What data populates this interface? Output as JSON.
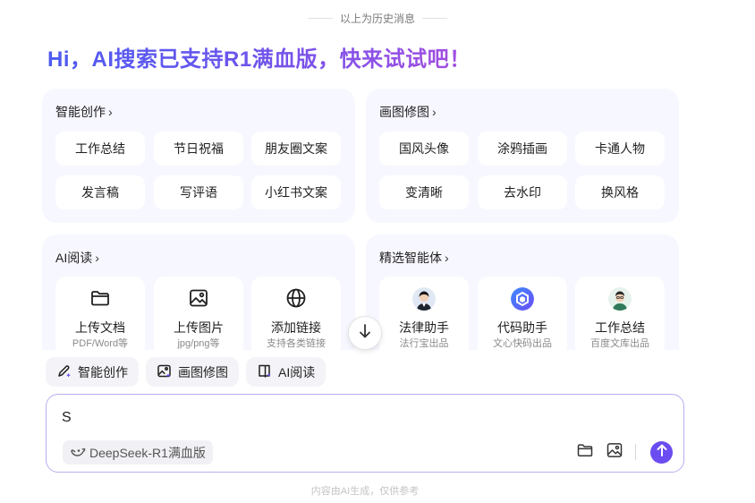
{
  "history_divider": "以上为历史消息",
  "greeting": "Hi，AI搜索已支持R1满血版，快来试试吧！",
  "cards": {
    "creation": {
      "title": "智能创作",
      "items": [
        "工作总结",
        "节日祝福",
        "朋友圈文案",
        "发言稿",
        "写评语",
        "小红书文案"
      ]
    },
    "drawing": {
      "title": "画图修图",
      "items": [
        "国风头像",
        "涂鸦插画",
        "卡通人物",
        "变清晰",
        "去水印",
        "换风格"
      ]
    },
    "reading": {
      "title": "AI阅读",
      "items": [
        {
          "label": "上传文档",
          "sub": "PDF/Word等",
          "icon": "folder-icon"
        },
        {
          "label": "上传图片",
          "sub": "jpg/png等",
          "icon": "image-icon"
        },
        {
          "label": "添加链接",
          "sub": "支持各类链接",
          "icon": "globe-icon"
        }
      ]
    },
    "agents": {
      "title": "精选智能体",
      "items": [
        {
          "label": "法律助手",
          "sub": "法行宝出品",
          "icon": "lawyer-avatar-icon"
        },
        {
          "label": "代码助手",
          "sub": "文心快码出品",
          "icon": "code-assistant-icon"
        },
        {
          "label": "工作总结",
          "sub": "百度文库出品",
          "icon": "office-worker-avatar-icon"
        }
      ]
    }
  },
  "quick_actions": [
    {
      "label": "智能创作",
      "icon": "pen-sparkle-icon"
    },
    {
      "label": "画图修图",
      "icon": "image-edit-icon"
    },
    {
      "label": "AI阅读",
      "icon": "book-icon"
    }
  ],
  "input": {
    "value": "S",
    "model_label": "DeepSeek-R1满血版"
  },
  "footer_note": "内容由AI生成，仅供参考",
  "colors": {
    "accent": "#6b4cf0",
    "card_bg": "#f7f7ff",
    "input_border": "#b8aef0"
  }
}
